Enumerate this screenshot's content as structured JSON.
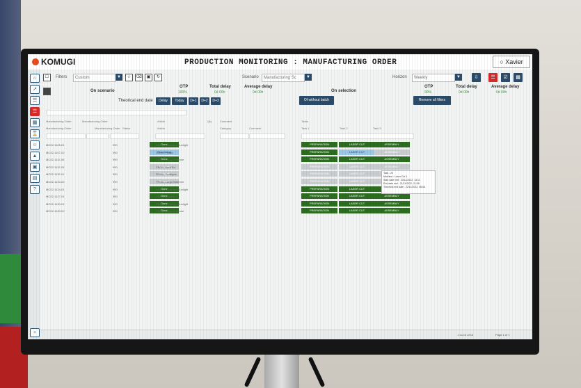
{
  "app": {
    "logo": "KOMUGI",
    "title": "PRODUCTION MONITORING : MANUFACTURING ORDER",
    "user": "Xavier"
  },
  "toolbar": {
    "filters_label": "Filters",
    "filters_value": "Custom",
    "scenario_label": "Scenario",
    "scenario_value": "Manufacturing Sc",
    "horizon_label": "Horizon",
    "horizon_value": "Weekly"
  },
  "kpis_scenario": {
    "section_label": "On scenario",
    "otp_label": "OTP",
    "otp_value": "100%",
    "total_delay_label": "Total delay",
    "total_delay_value": "0d 00h",
    "avg_delay_label": "Average delay",
    "avg_delay_value": "0d 00h"
  },
  "kpis_selection": {
    "section_label": "On selection",
    "otp_label": "OTP",
    "otp_value": "90%",
    "total_delay_label": "Total delay",
    "total_delay_value": "0d 00h",
    "avg_delay_label": "Average delay",
    "avg_delay_value": "0d 00h"
  },
  "date_filter": {
    "label": "Theorical end date",
    "buttons": [
      "Delay",
      "Today",
      "D+1",
      "D+2",
      "D+3"
    ]
  },
  "of_without_batch": "Of without batch",
  "remove_filters": "Remove all filters",
  "table": {
    "column_headers": [
      "Manufacturing Order",
      "Manufacturing Order",
      "Status",
      "Article",
      "Qty",
      "Category",
      "Comment"
    ],
    "task_headers": [
      "Task 1",
      "Task 2",
      "Task 3"
    ],
    "tasks_group_label": "Tasks",
    "rows": [
      {
        "mo": "MO22-1105-01",
        "prio": "990",
        "status": "Done",
        "status_class": "Done",
        "article": "BM011 Quadrilex Sunlight",
        "tasks": [
          "PREPARATION",
          "LASER CUT",
          "ASSEMBLY"
        ],
        "task_classes": [
          "",
          "",
          ""
        ]
      },
      {
        "mo": "MO22-1107-02",
        "prio": "990",
        "status": "Processing",
        "status_class": "Processing",
        "article": "CB001 Plastic",
        "tasks": [
          "PREPARATION",
          "LASER CUT",
          "ASSEMBLY"
        ],
        "task_classes": [
          "",
          "cur",
          "gray"
        ]
      },
      {
        "mo": "MO22-1112-06",
        "prio": "990",
        "status": "Done",
        "status_class": "Done",
        "article": "TR001 Cargo Italienne",
        "tasks": [
          "PREPARATION",
          "LASER CUT",
          "ASSEMBLY"
        ],
        "task_classes": [
          "",
          "",
          ""
        ]
      },
      {
        "mo": "MO22-1112-03",
        "prio": "990",
        "status": "Delayed",
        "status_class": "Delayed",
        "article": "CB001 Bord Bo",
        "tasks": [
          "PREPARATION",
          "LASER CUT",
          "ASSEMBLY"
        ],
        "task_classes": [
          "gray",
          "gray",
          "gray"
        ]
      },
      {
        "mo": "MO22-1115-01",
        "prio": "990",
        "status": "Delayed",
        "status_class": "Delayed",
        "article": "SO001 Protégée",
        "tasks": [
          "PREPARATION",
          "LASER CUT",
          "ASSEMBLY"
        ],
        "task_classes": [
          "gray",
          "gray",
          "gray"
        ]
      },
      {
        "mo": "MO22-1120-02",
        "prio": "990",
        "status": "Delayed",
        "status_class": "Delayed",
        "article": "TR001 Cargo Italienne",
        "tasks": [
          "PREPARATION",
          "LASER CUT",
          "ASSEMBLY"
        ],
        "task_classes": [
          "gray",
          "gray",
          "gray"
        ]
      },
      {
        "mo": "MO22-1124-01",
        "prio": "990",
        "status": "Done",
        "status_class": "Done",
        "article": "BM011 Quadrilex Sunlight",
        "tasks": [
          "PREPARATION",
          "LASER CUT",
          "ASSEMBLY"
        ],
        "task_classes": [
          "",
          "",
          ""
        ]
      },
      {
        "mo": "MO22-1127-01",
        "prio": "990",
        "status": "Done",
        "status_class": "Done",
        "article": "CB001 Quadrilex",
        "tasks": [
          "PREPARATION",
          "LASER CUT",
          "ASSEMBLY"
        ],
        "task_classes": [
          "",
          "",
          ""
        ]
      },
      {
        "mo": "MO22-1130-01",
        "prio": "990",
        "status": "Done",
        "status_class": "Done",
        "article": "BM011 Quadrilex Sunlight",
        "tasks": [
          "PREPARATION",
          "LASER CUT",
          "ASSEMBLY"
        ],
        "task_classes": [
          "",
          "",
          ""
        ]
      },
      {
        "mo": "MO22-1130-02",
        "prio": "990",
        "status": "Done",
        "status_class": "Done",
        "article": "TR001 Cargo Italienne",
        "tasks": [
          "PREPARATION",
          "LASER CUT",
          "ASSEMBLY"
        ],
        "task_classes": [
          "",
          "",
          ""
        ]
      }
    ]
  },
  "tooltip": {
    "lines": [
      "Task : 20",
      "Machine : Laser Cut 1",
      "Start date real : 20/11/2022, 13:11",
      "End date real : 21/11/2022, 21:08",
      "Theorical end date : 22/11/2022, 08:08"
    ]
  },
  "footer": {
    "count": "1 to 10 of 10",
    "page": "Page 1 of 1"
  },
  "colors": {
    "done": "#2c6e1f",
    "processing": "#9bc8e6",
    "delayed": "#c9cdd0",
    "primary": "#2a4b6a",
    "accent": "#d62a2a"
  }
}
